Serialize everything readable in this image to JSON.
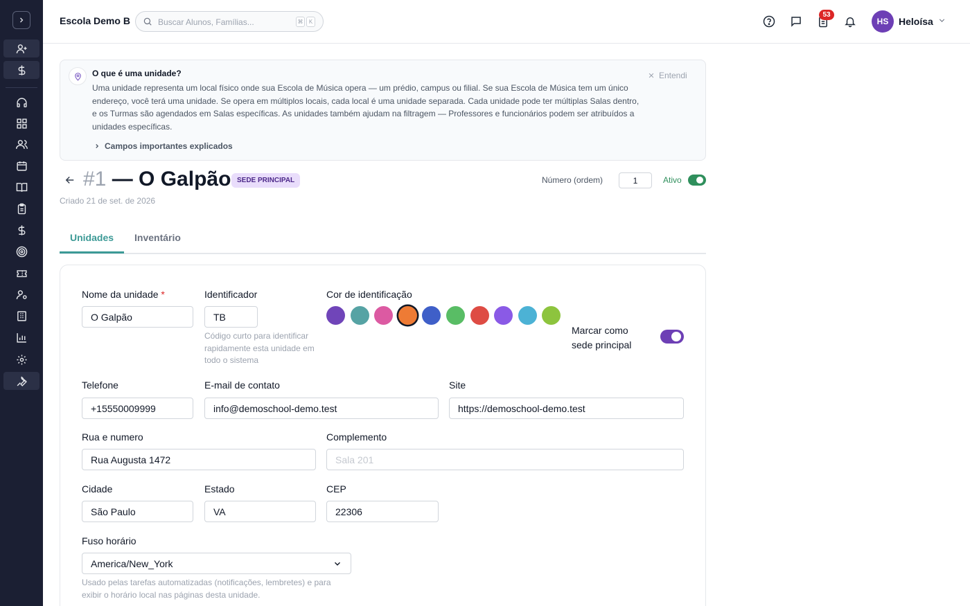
{
  "app": {
    "school_name": "Escola Demo B"
  },
  "search": {
    "placeholder": "Buscar Alunos, Famílias...",
    "kbd_1": "⌘",
    "kbd_2": "K"
  },
  "topbar": {
    "notifications_count": "53",
    "user_initials": "HS",
    "user_name": "Heloísa"
  },
  "sidebar": {
    "items": [
      "add-user-icon",
      "dollar-icon",
      "headset-icon",
      "dashboard-icon",
      "users-icon",
      "calendar-icon",
      "book-icon",
      "clipboard-icon",
      "dollar-icon",
      "target-icon",
      "ticket-icon",
      "user-cog-icon",
      "building-icon",
      "chart-icon",
      "gear-icon",
      "wrench-icon"
    ]
  },
  "banner": {
    "title": "O que é uma unidade?",
    "text": "Uma unidade representa um local físico onde sua Escola de Música opera — um prédio, campus ou filial. Se sua Escola de Música tem um único endereço, você terá uma unidade. Se opera em múltiplos locais, cada local é uma unidade separada. Cada unidade pode ter múltiplas Salas dentro, e os Turmas são agendados em Salas específicas. As unidades também ajudam na filtragem — Professores e funcionários podem ser atribuídos a unidades específicas.",
    "dismiss_label": "Entendi",
    "expand_label": "Campos importantes explicados"
  },
  "header": {
    "number": "#1",
    "title": "— O Galpão",
    "badge": "SEDE PRINCIPAL",
    "created": "Criado 21 de set. de 2026",
    "order_label": "Número (ordem)",
    "order_value": "1",
    "active_label": "Ativo",
    "active_on": true
  },
  "tabs": [
    {
      "label": "Unidades",
      "active": true
    },
    {
      "label": "Inventário",
      "active": false
    }
  ],
  "form": {
    "name_label": "Nome da unidade",
    "name_required": "*",
    "name_value": "O Galpão",
    "code_label": "Identificador",
    "code_value": "TB",
    "code_help": "Código curto para identificar rapidamente esta unidade em todo o sistema",
    "color_label": "Cor de identificação",
    "colors": [
      "#7045b9",
      "#56a3a4",
      "#dc5aa2",
      "#ee7b35",
      "#3f5fc8",
      "#59bd65",
      "#de4c44",
      "#8a5ae6",
      "#4cb2d5",
      "#8dc43e"
    ],
    "selected_color": "#ee7b35",
    "main_label": "Marcar como sede principal",
    "main_on": true,
    "phone_label": "Telefone",
    "phone_value": "+15550009999",
    "email_label": "E-mail de contato",
    "email_value": "info@demoschool-demo.test",
    "site_label": "Site",
    "site_value": "https://demoschool-demo.test",
    "street_label": "Rua e numero",
    "street_value": "Rua Augusta 1472",
    "complement_label": "Complemento",
    "complement_placeholder": "Sala 201",
    "city_label": "Cidade",
    "city_value": "São Paulo",
    "state_label": "Estado",
    "state_value": "VA",
    "zip_label": "CEP",
    "zip_value": "22306",
    "tz_label": "Fuso horário",
    "tz_value": "America/New_York",
    "tz_help": "Usado pelas tarefas automatizadas (notificações, lembretes) e para exibir o horário local nas páginas desta unidade."
  },
  "colors": {
    "accent_teal": "#3c9a96",
    "toggle_active": "#2f8f5c",
    "toggle_main": "#6d3fb5",
    "sidebar_bg": "#1b1f33"
  }
}
